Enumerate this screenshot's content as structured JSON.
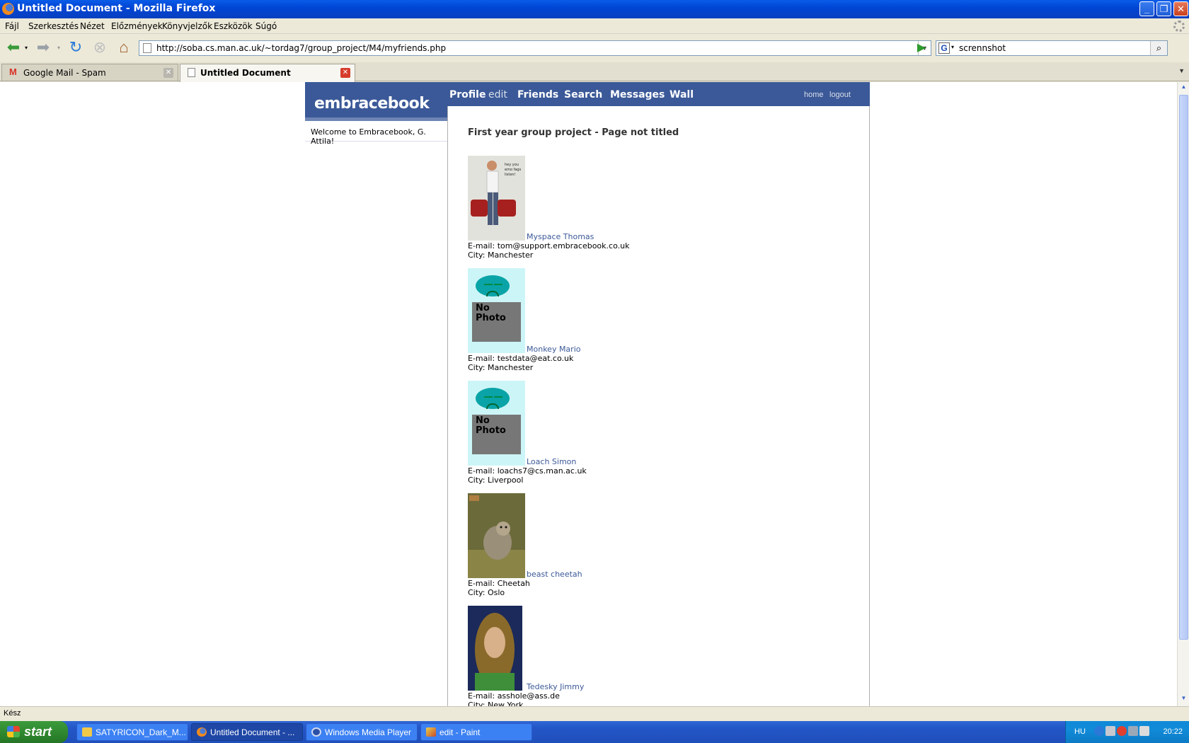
{
  "window": {
    "title": "Untitled Document - Mozilla Firefox"
  },
  "menu": [
    "Fájl",
    "Szerkesztés",
    "Nézet",
    "Előzmények",
    "Könyvjelzők",
    "Eszközök",
    "Súgó"
  ],
  "nav": {
    "url": "http://soba.cs.man.ac.uk/~tordag7/group_project/M4/myfriends.php",
    "search_value": "scrennshot"
  },
  "tabs": [
    {
      "label": "Google Mail - Spam"
    },
    {
      "label": "Untitled Document"
    }
  ],
  "site": {
    "logo": "embracebook",
    "nav": {
      "profile": "Profile",
      "edit": "edit",
      "friends": "Friends",
      "search": "Search",
      "messages": "Messages",
      "wall": "Wall",
      "home": "home",
      "logout": "logout"
    },
    "welcome": "Welcome to Embracebook, G. Attila!",
    "heading": "First year group project - Page not titled",
    "nophoto_text": "No\nPhoto",
    "friends": [
      {
        "name": "Myspace Thomas",
        "email": "E-mail: tom@support.embracebook.co.uk",
        "city": "City: Manchester",
        "photo": "photo-man-with-bags"
      },
      {
        "name": "Monkey Mario",
        "email": "E-mail: testdata@eat.co.uk",
        "city": "City: Manchester",
        "photo": "no-photo"
      },
      {
        "name": "Loach Simon",
        "email": "E-mail: loachs7@cs.man.ac.uk",
        "city": "City: Liverpool",
        "photo": "no-photo"
      },
      {
        "name": "beast cheetah",
        "email": "E-mail: Cheetah",
        "city": "City: Oslo",
        "photo": "photo-cheetah-cub"
      },
      {
        "name": "Tedesky Jimmy",
        "email": "E-mail: asshole@ass.de",
        "city": "City: New York",
        "photo": "photo-long-hair-man"
      }
    ]
  },
  "status": "Kész",
  "taskbar": {
    "start": "start",
    "buttons": [
      "SATYRICON_Dark_M...",
      "Untitled Document - ...",
      "Windows Media Player",
      "edit - Paint"
    ],
    "lang": "HU",
    "clock": "20:22"
  },
  "colors": {
    "brand": "#3b5998",
    "brand_light": "#6d84b4",
    "link": "#3b5998"
  }
}
